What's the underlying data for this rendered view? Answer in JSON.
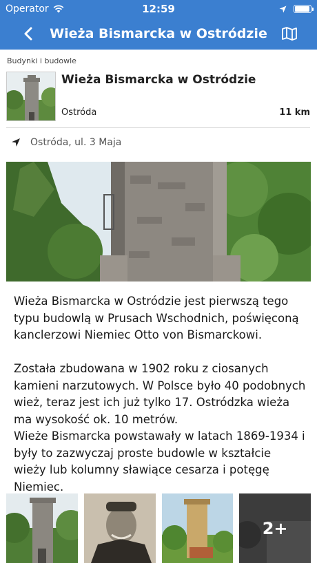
{
  "status": {
    "carrier": "Operator",
    "time": "12:59"
  },
  "nav": {
    "title": "Wieża Bismarcka w Ostródzie",
    "back_icon": "chevron-left-icon",
    "map_icon": "map-icon"
  },
  "category": "Budynki i budowle",
  "place": {
    "name": "Wieża Bismarcka w Ostródzie",
    "town": "Ostróda",
    "distance": "11 km"
  },
  "address": "Ostróda, ul. 3 Maja",
  "description": {
    "p1": "Wieża Bismarcka w Ostródzie jest pierwszą tego typu budowlą w Prusach Wschodnich, poświęconą kanclerzowi Niemiec Otto von Bismarckowi.",
    "p2": "Została zbudowana w 1902 roku z ciosanych kamieni narzutowych. W Polsce było 40 podobnych wież, teraz jest ich już tylko 17. Ostródzka wieża ma wysokość ok. 10 metrów.",
    "p3": "Wieże Bismarcka powstawały w latach 1869-1934 i były to zazwyczaj proste budowle w kształcie wieży lub kolumny sławiące cesarza i potęgę Niemiec."
  },
  "gallery": {
    "more_label": "2+"
  },
  "colors": {
    "accent": "#3b7fd0"
  }
}
